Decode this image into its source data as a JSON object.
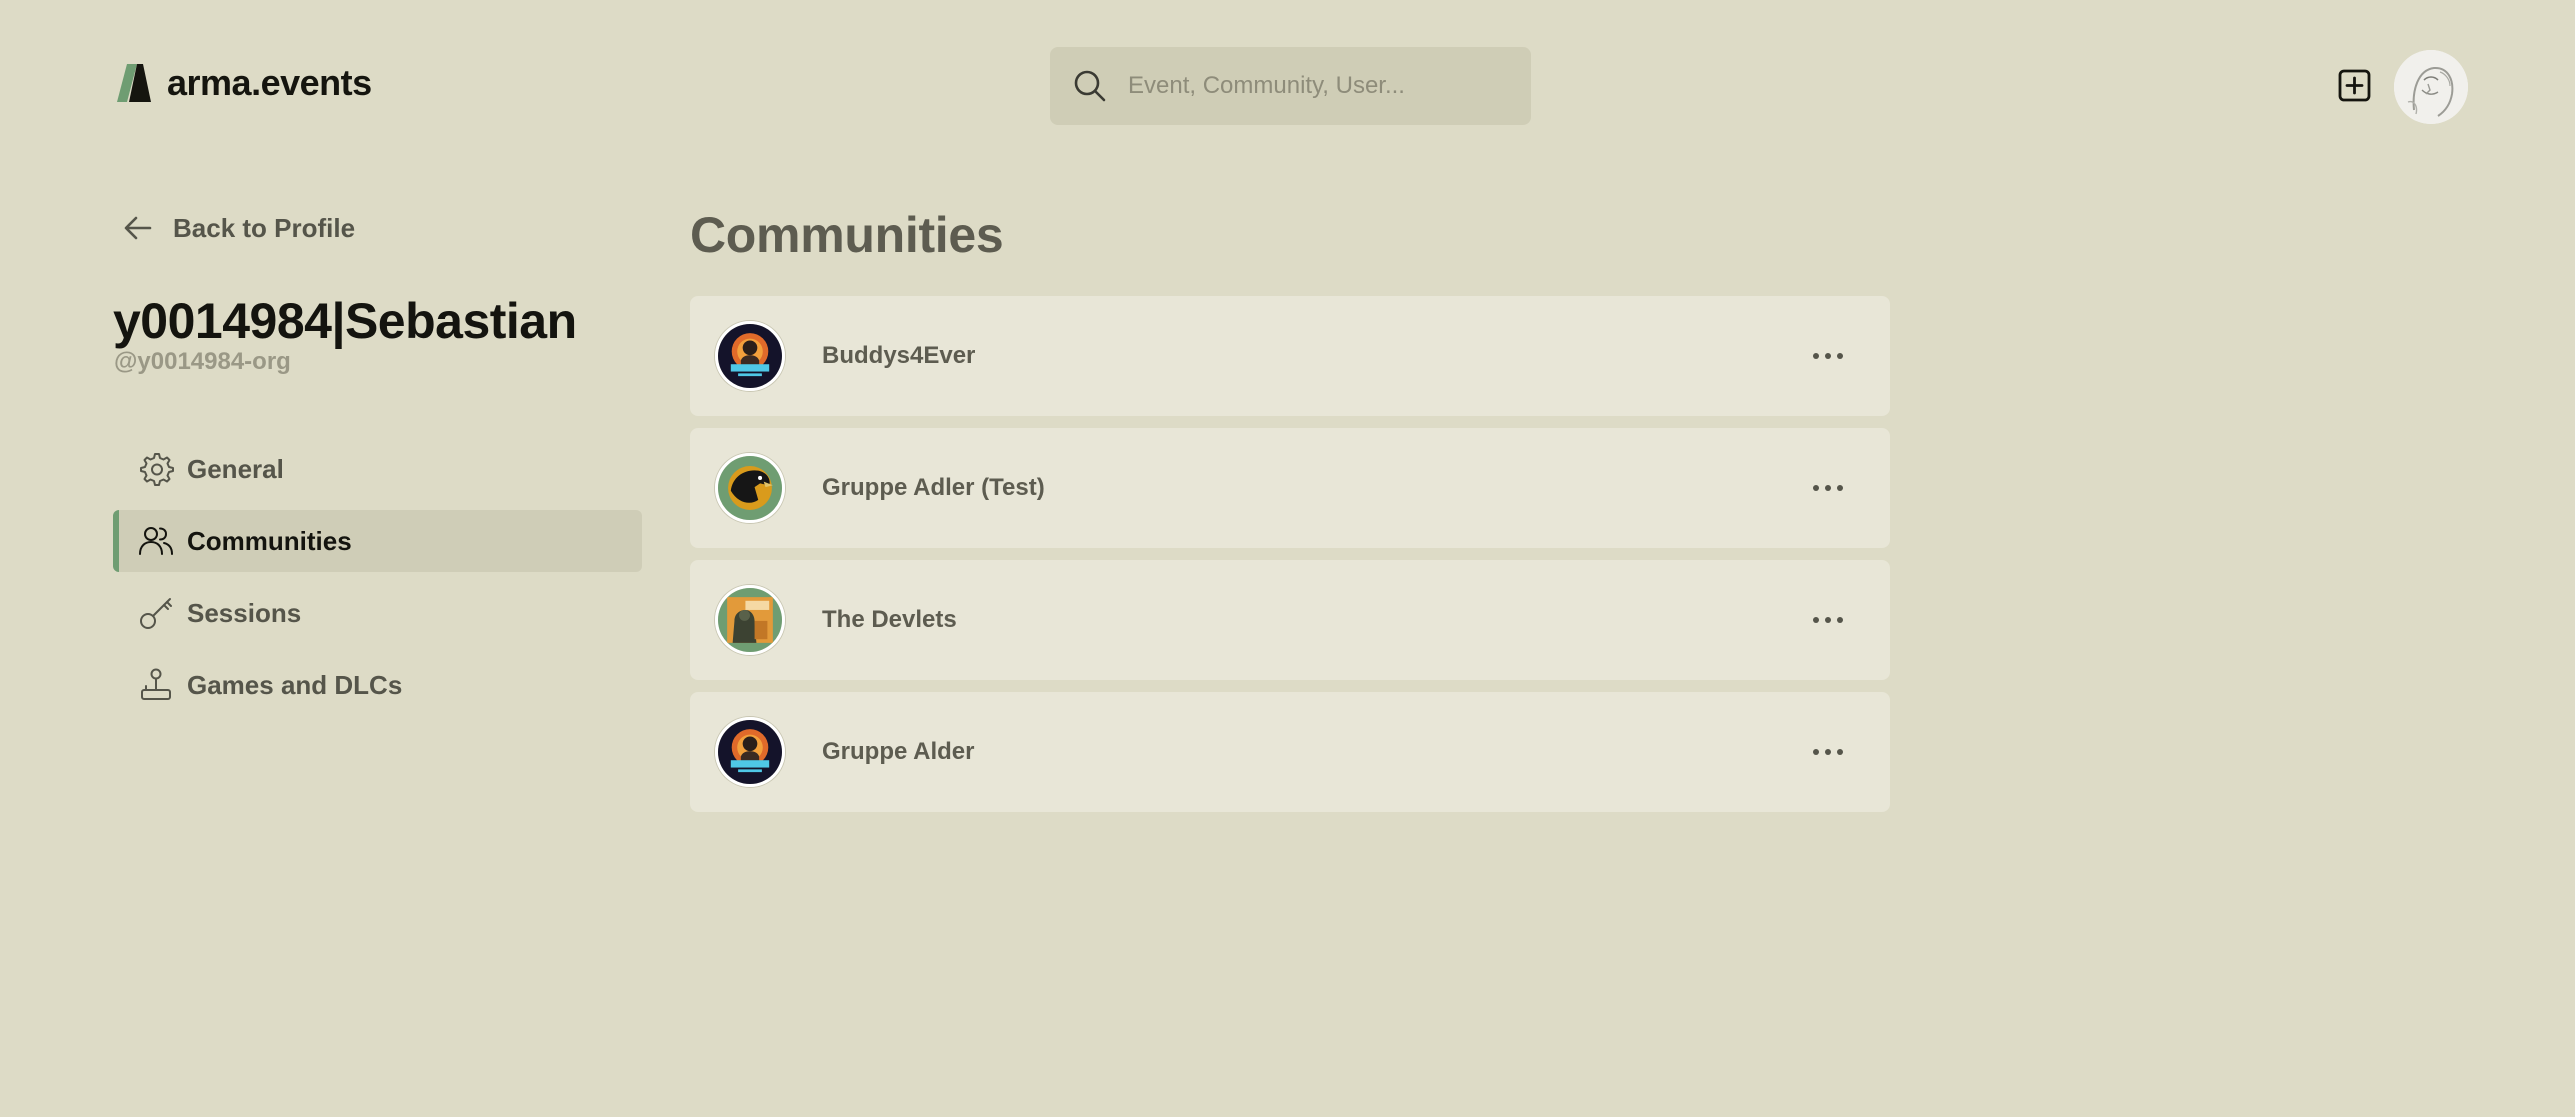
{
  "header": {
    "logo_text": "arma.events",
    "search_placeholder": "Event, Community, User..."
  },
  "sidebar": {
    "back_label": "Back to Profile",
    "user_name": "y0014984|Sebastian",
    "user_handle": "@y0014984-org",
    "items": [
      {
        "label": "General",
        "icon": "gear-icon",
        "active": false
      },
      {
        "label": "Communities",
        "icon": "users-icon",
        "active": true
      },
      {
        "label": "Sessions",
        "icon": "key-icon",
        "active": false
      },
      {
        "label": "Games and DLCs",
        "icon": "joystick-icon",
        "active": false
      }
    ]
  },
  "main": {
    "title": "Communities",
    "communities": [
      {
        "name": "Buddys4Ever",
        "logo": "buddys4-logo"
      },
      {
        "name": "Gruppe Adler (Test)",
        "logo": "adler-logo"
      },
      {
        "name": "The Devlets",
        "logo": "devlets-logo"
      },
      {
        "name": "Gruppe Alder",
        "logo": "buddys4-logo"
      }
    ]
  },
  "colors": {
    "background": "#dddbc6",
    "card": "#e8e6d7",
    "accent": "#6f9d72",
    "search_bg": "#cfcdb6"
  }
}
